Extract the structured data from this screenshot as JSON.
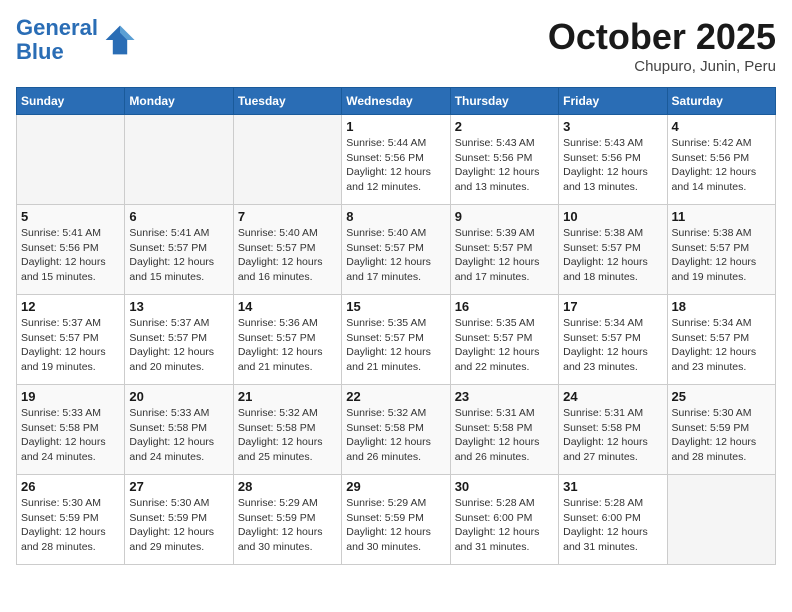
{
  "header": {
    "logo_line1": "General",
    "logo_line2": "Blue",
    "month": "October 2025",
    "location": "Chupuro, Junin, Peru"
  },
  "weekdays": [
    "Sunday",
    "Monday",
    "Tuesday",
    "Wednesday",
    "Thursday",
    "Friday",
    "Saturday"
  ],
  "weeks": [
    [
      {
        "day": "",
        "empty": true
      },
      {
        "day": "",
        "empty": true
      },
      {
        "day": "",
        "empty": true
      },
      {
        "day": "1",
        "sunrise": "5:44 AM",
        "sunset": "5:56 PM",
        "daylight": "12 hours and 12 minutes."
      },
      {
        "day": "2",
        "sunrise": "5:43 AM",
        "sunset": "5:56 PM",
        "daylight": "12 hours and 13 minutes."
      },
      {
        "day": "3",
        "sunrise": "5:43 AM",
        "sunset": "5:56 PM",
        "daylight": "12 hours and 13 minutes."
      },
      {
        "day": "4",
        "sunrise": "5:42 AM",
        "sunset": "5:56 PM",
        "daylight": "12 hours and 14 minutes."
      }
    ],
    [
      {
        "day": "5",
        "sunrise": "5:41 AM",
        "sunset": "5:56 PM",
        "daylight": "12 hours and 15 minutes."
      },
      {
        "day": "6",
        "sunrise": "5:41 AM",
        "sunset": "5:57 PM",
        "daylight": "12 hours and 15 minutes."
      },
      {
        "day": "7",
        "sunrise": "5:40 AM",
        "sunset": "5:57 PM",
        "daylight": "12 hours and 16 minutes."
      },
      {
        "day": "8",
        "sunrise": "5:40 AM",
        "sunset": "5:57 PM",
        "daylight": "12 hours and 17 minutes."
      },
      {
        "day": "9",
        "sunrise": "5:39 AM",
        "sunset": "5:57 PM",
        "daylight": "12 hours and 17 minutes."
      },
      {
        "day": "10",
        "sunrise": "5:38 AM",
        "sunset": "5:57 PM",
        "daylight": "12 hours and 18 minutes."
      },
      {
        "day": "11",
        "sunrise": "5:38 AM",
        "sunset": "5:57 PM",
        "daylight": "12 hours and 19 minutes."
      }
    ],
    [
      {
        "day": "12",
        "sunrise": "5:37 AM",
        "sunset": "5:57 PM",
        "daylight": "12 hours and 19 minutes."
      },
      {
        "day": "13",
        "sunrise": "5:37 AM",
        "sunset": "5:57 PM",
        "daylight": "12 hours and 20 minutes."
      },
      {
        "day": "14",
        "sunrise": "5:36 AM",
        "sunset": "5:57 PM",
        "daylight": "12 hours and 21 minutes."
      },
      {
        "day": "15",
        "sunrise": "5:35 AM",
        "sunset": "5:57 PM",
        "daylight": "12 hours and 21 minutes."
      },
      {
        "day": "16",
        "sunrise": "5:35 AM",
        "sunset": "5:57 PM",
        "daylight": "12 hours and 22 minutes."
      },
      {
        "day": "17",
        "sunrise": "5:34 AM",
        "sunset": "5:57 PM",
        "daylight": "12 hours and 23 minutes."
      },
      {
        "day": "18",
        "sunrise": "5:34 AM",
        "sunset": "5:57 PM",
        "daylight": "12 hours and 23 minutes."
      }
    ],
    [
      {
        "day": "19",
        "sunrise": "5:33 AM",
        "sunset": "5:58 PM",
        "daylight": "12 hours and 24 minutes."
      },
      {
        "day": "20",
        "sunrise": "5:33 AM",
        "sunset": "5:58 PM",
        "daylight": "12 hours and 24 minutes."
      },
      {
        "day": "21",
        "sunrise": "5:32 AM",
        "sunset": "5:58 PM",
        "daylight": "12 hours and 25 minutes."
      },
      {
        "day": "22",
        "sunrise": "5:32 AM",
        "sunset": "5:58 PM",
        "daylight": "12 hours and 26 minutes."
      },
      {
        "day": "23",
        "sunrise": "5:31 AM",
        "sunset": "5:58 PM",
        "daylight": "12 hours and 26 minutes."
      },
      {
        "day": "24",
        "sunrise": "5:31 AM",
        "sunset": "5:58 PM",
        "daylight": "12 hours and 27 minutes."
      },
      {
        "day": "25",
        "sunrise": "5:30 AM",
        "sunset": "5:59 PM",
        "daylight": "12 hours and 28 minutes."
      }
    ],
    [
      {
        "day": "26",
        "sunrise": "5:30 AM",
        "sunset": "5:59 PM",
        "daylight": "12 hours and 28 minutes."
      },
      {
        "day": "27",
        "sunrise": "5:30 AM",
        "sunset": "5:59 PM",
        "daylight": "12 hours and 29 minutes."
      },
      {
        "day": "28",
        "sunrise": "5:29 AM",
        "sunset": "5:59 PM",
        "daylight": "12 hours and 30 minutes."
      },
      {
        "day": "29",
        "sunrise": "5:29 AM",
        "sunset": "5:59 PM",
        "daylight": "12 hours and 30 minutes."
      },
      {
        "day": "30",
        "sunrise": "5:28 AM",
        "sunset": "6:00 PM",
        "daylight": "12 hours and 31 minutes."
      },
      {
        "day": "31",
        "sunrise": "5:28 AM",
        "sunset": "6:00 PM",
        "daylight": "12 hours and 31 minutes."
      },
      {
        "day": "",
        "empty": true
      }
    ]
  ],
  "labels": {
    "sunrise_prefix": "Sunrise: ",
    "sunset_prefix": "Sunset: ",
    "daylight_prefix": "Daylight: "
  }
}
